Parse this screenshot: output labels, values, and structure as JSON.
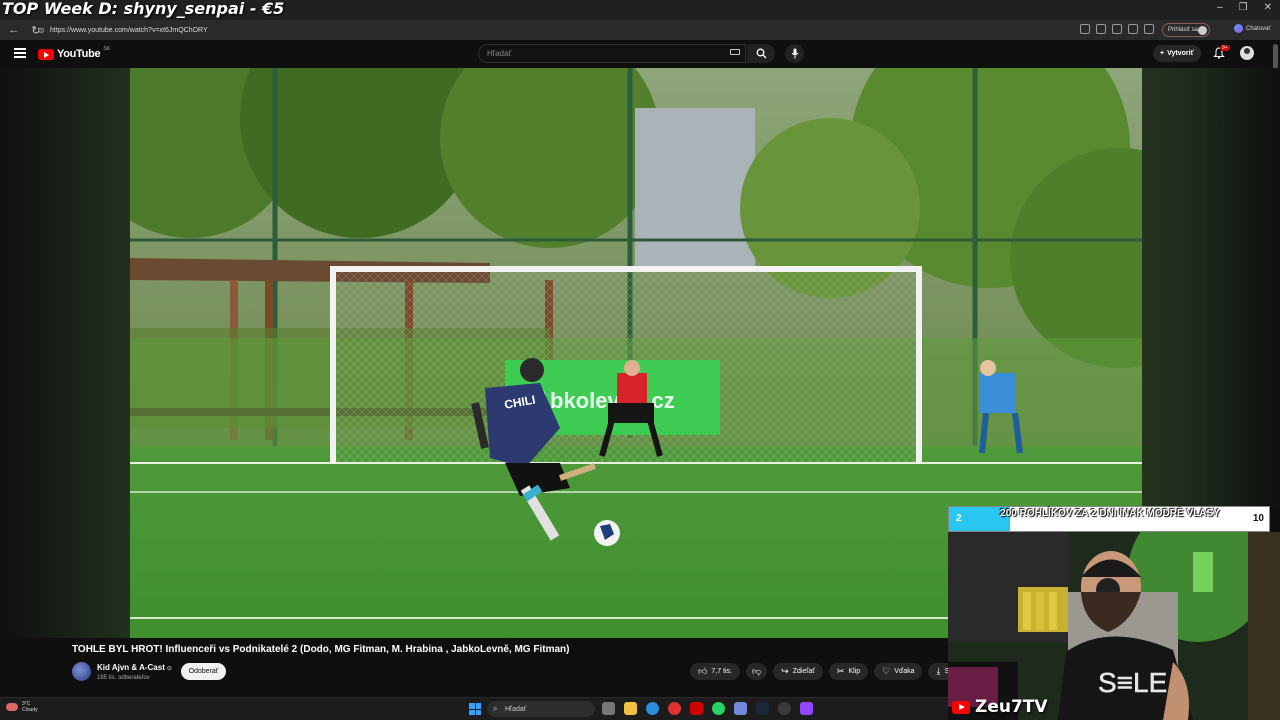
{
  "overlay": {
    "top_banner": "TOP Week D: shyny_senpai - €5",
    "goal_start": "2",
    "goal_text": "200 ROHLÍKOV ZA 2 DNI INAK MODRÉ VLASY",
    "goal_end": "10",
    "goal_fraction": 0.19,
    "streamer_name": "Zeu7TV"
  },
  "browser": {
    "url": "https://www.youtube.com/watch?v=xt6JmQChORY",
    "signin_label": "Prihlásiť sa",
    "chat_label": "Chatovať"
  },
  "youtube": {
    "logo_text": "YouTube",
    "country_code": "SK",
    "search_placeholder": "Hľadať",
    "create_label": "Vytvoriť",
    "notifications_badge": "9+"
  },
  "video": {
    "title": "TOHLE BYL HROT! Influenceři vs Podnikatelé 2 (Dodo, MG Fitman, M. Hrabina , JabkoLevně, MG Fitman)",
    "channel": "Kid Ajvn & A-Cast",
    "subscribers": "185 tis. odberateľov",
    "subscribe_label": "Odoberať",
    "actions": {
      "likes": "7,7 tis.",
      "share": "Zdieľať",
      "clip": "Klip",
      "thanks": "Vďaka",
      "download": "Stia"
    },
    "banner_text": "bkolevne.cz",
    "shirt_text": "CHILI"
  },
  "taskbar": {
    "temp": "3°C",
    "weather": "Cloudy",
    "search_placeholder": "Hľadať"
  },
  "colors": {
    "youtube_red": "#ff0000",
    "goal_fill": "#29c7f0",
    "banner_green": "#3fcc54"
  }
}
